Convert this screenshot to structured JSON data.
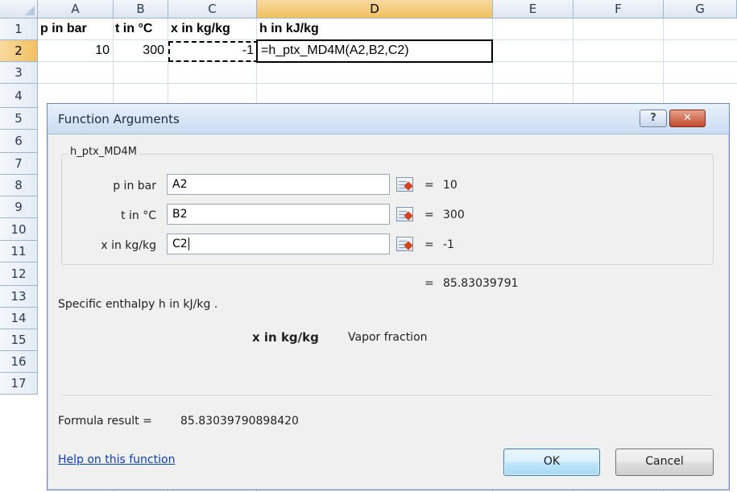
{
  "spreadsheet": {
    "corner": "",
    "columns": [
      "A",
      "B",
      "C",
      "D",
      "E",
      "F",
      "G"
    ],
    "rows": [
      "1",
      "2",
      "3",
      "4",
      "5",
      "6",
      "7",
      "8",
      "9",
      "10",
      "11",
      "12",
      "13",
      "14",
      "15",
      "16",
      "17"
    ],
    "selected_column": "D",
    "selected_row": "2",
    "cells": {
      "A1": "p in bar",
      "B1": "t in °C",
      "C1": "x in kg/kg",
      "D1": "h in kJ/kg",
      "A2": "10",
      "B2": "300",
      "C2": "-1",
      "D2": "=h_ptx_MD4M(A2,B2,C2)"
    }
  },
  "dialog": {
    "title": "Function Arguments",
    "help_button": "?",
    "close_button": "✕",
    "function_name": "h_ptx_MD4M",
    "arguments": [
      {
        "label": "p in bar",
        "value": "A2",
        "result": "10"
      },
      {
        "label": "t in °C",
        "value": "B2",
        "result": "300"
      },
      {
        "label": "x in kg/kg",
        "value": "C2",
        "result": "-1"
      }
    ],
    "equals": "=",
    "function_result": "85.83039791",
    "description": "Specific enthalpy h in kJ/kg .",
    "arg_name": "x in kg/kg",
    "arg_description": "Vapor fraction",
    "formula_result_label": "Formula result =",
    "formula_result_value": "85.83039790898420",
    "help_link": "Help on this function",
    "ok_label": "OK",
    "cancel_label": "Cancel"
  },
  "colors": {
    "header_bg": "#dde5f0",
    "selected_header_bg": "#f1c15f",
    "dialog_bg": "#f0f0f0",
    "link": "#0b3fb5"
  }
}
